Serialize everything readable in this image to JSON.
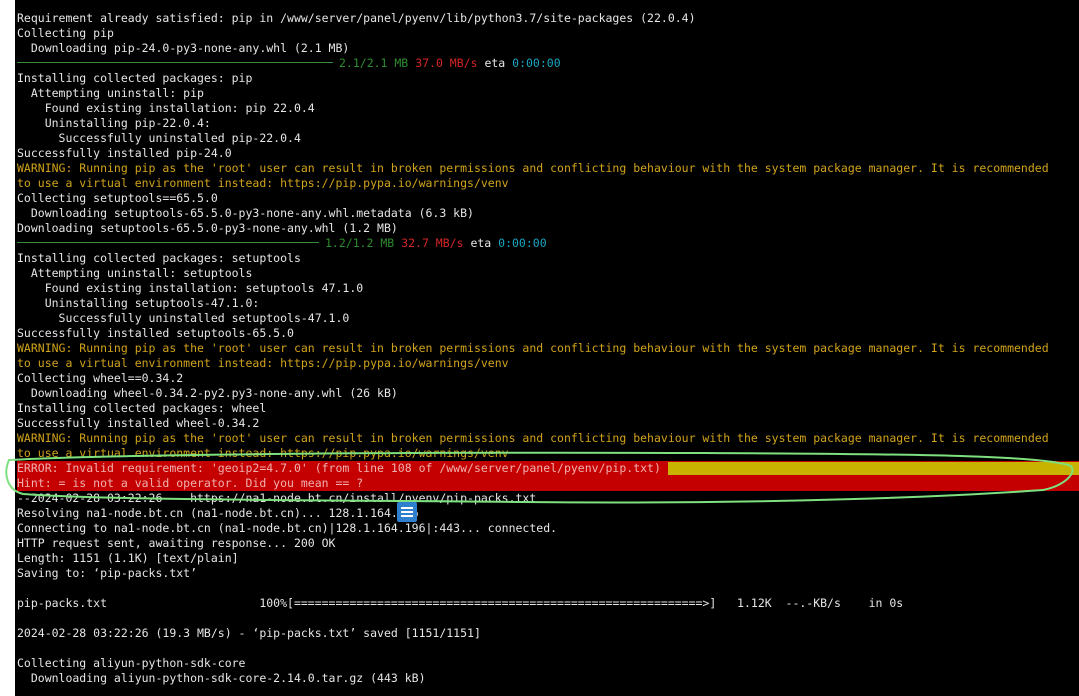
{
  "terminal": {
    "lines": [
      {
        "segs": [
          {
            "t": "Requirement already satisfied: pip in /www/server/panel/pyenv/lib/python3.7/site-packages (22.0.4)",
            "c": "white"
          }
        ]
      },
      {
        "segs": [
          {
            "t": "Collecting pip",
            "c": "white"
          }
        ]
      },
      {
        "segs": [
          {
            "t": "  Downloading pip-24.0-py3-none-any.whl (2.1 MB)",
            "c": "white"
          }
        ]
      },
      {
        "bar": {
          "width": 316,
          "progress": "2.1/2.1 MB",
          "speed": "37.0 MB/s",
          "eta_label": "eta",
          "eta": "0:00:00"
        }
      },
      {
        "segs": [
          {
            "t": "Installing collected packages: pip",
            "c": "white"
          }
        ]
      },
      {
        "segs": [
          {
            "t": "  Attempting uninstall: pip",
            "c": "white"
          }
        ]
      },
      {
        "segs": [
          {
            "t": "    Found existing installation: pip 22.0.4",
            "c": "white"
          }
        ]
      },
      {
        "segs": [
          {
            "t": "    Uninstalling pip-22.0.4:",
            "c": "white"
          }
        ]
      },
      {
        "segs": [
          {
            "t": "      Successfully uninstalled pip-22.0.4",
            "c": "white"
          }
        ]
      },
      {
        "segs": [
          {
            "t": "Successfully installed pip-24.0",
            "c": "white"
          }
        ]
      },
      {
        "segs": [
          {
            "t": "WARNING: Running pip as the 'root' user can result in broken permissions and conflicting behaviour with the system package manager. It is recommended",
            "c": "yellow"
          }
        ]
      },
      {
        "segs": [
          {
            "t": "to use a virtual environment instead: https://pip.pypa.io/warnings/venv",
            "c": "yellow"
          }
        ]
      },
      {
        "segs": [
          {
            "t": "Collecting setuptools==65.5.0",
            "c": "white"
          }
        ]
      },
      {
        "segs": [
          {
            "t": "  Downloading setuptools-65.5.0-py3-none-any.whl.metadata (6.3 kB)",
            "c": "white"
          }
        ]
      },
      {
        "segs": [
          {
            "t": "Downloading setuptools-65.5.0-py3-none-any.whl (1.2 MB)",
            "c": "white"
          }
        ]
      },
      {
        "bar": {
          "width": 302,
          "progress": "1.2/1.2 MB",
          "speed": "32.7 MB/s",
          "eta_label": "eta",
          "eta": "0:00:00"
        }
      },
      {
        "segs": [
          {
            "t": "Installing collected packages: setuptools",
            "c": "white"
          }
        ]
      },
      {
        "segs": [
          {
            "t": "  Attempting uninstall: setuptools",
            "c": "white"
          }
        ]
      },
      {
        "segs": [
          {
            "t": "    Found existing installation: setuptools 47.1.0",
            "c": "white"
          }
        ]
      },
      {
        "segs": [
          {
            "t": "    Uninstalling setuptools-47.1.0:",
            "c": "white"
          }
        ]
      },
      {
        "segs": [
          {
            "t": "      Successfully uninstalled setuptools-47.1.0",
            "c": "white"
          }
        ]
      },
      {
        "segs": [
          {
            "t": "Successfully installed setuptools-65.5.0",
            "c": "white"
          }
        ]
      },
      {
        "segs": [
          {
            "t": "WARNING: Running pip as the 'root' user can result in broken permissions and conflicting behaviour with the system package manager. It is recommended",
            "c": "yellow"
          }
        ]
      },
      {
        "segs": [
          {
            "t": "to use a virtual environment instead: https://pip.pypa.io/warnings/venv",
            "c": "yellow"
          }
        ]
      },
      {
        "segs": [
          {
            "t": "Collecting wheel==0.34.2",
            "c": "white"
          }
        ]
      },
      {
        "segs": [
          {
            "t": "  Downloading wheel-0.34.2-py2.py3-none-any.whl (26 kB)",
            "c": "white"
          }
        ]
      },
      {
        "segs": [
          {
            "t": "Installing collected packages: wheel",
            "c": "white"
          }
        ]
      },
      {
        "segs": [
          {
            "t": "Successfully installed wheel-0.34.2",
            "c": "white"
          }
        ]
      },
      {
        "segs": [
          {
            "t": "WARNING: Running pip as the 'root' user can result in broken permissions and conflicting behaviour with the system package manager. It is recommended",
            "c": "yellow"
          }
        ]
      },
      {
        "segs": [
          {
            "t": "to use a virtual environment instead: https://pip.pypa.io/warnings/venv",
            "c": "yellow"
          }
        ]
      },
      {
        "error": "a",
        "segs": [
          {
            "t": "ERROR: Invalid requirement: 'geoip2=4.7.0' (from line 108 of /www/server/panel/pyenv/pip.txt)",
            "c": "red"
          }
        ]
      },
      {
        "error": "b",
        "segs": [
          {
            "t": "Hint: = is not a valid operator. Did you mean == ?",
            "c": "red"
          }
        ]
      },
      {
        "segs": [
          {
            "t": "--2024-02-28 03:22:26--  https://na1-node.bt.cn/install/pyenv/pip-packs.txt",
            "c": "white"
          }
        ]
      },
      {
        "segs": [
          {
            "t": "Resolving na1-node.bt.cn (na1-node.bt.cn)... 128.1.164.196",
            "c": "white"
          }
        ]
      },
      {
        "segs": [
          {
            "t": "Connecting to na1-node.bt.cn (na1-node.bt.cn)|128.1.164.196|:443... connected.",
            "c": "white"
          }
        ]
      },
      {
        "segs": [
          {
            "t": "HTTP request sent, awaiting response... 200 OK",
            "c": "white"
          }
        ]
      },
      {
        "segs": [
          {
            "t": "Length: 1151 (1.1K) [text/plain]",
            "c": "white"
          }
        ]
      },
      {
        "segs": [
          {
            "t": "Saving to: ‘pip-packs.txt’",
            "c": "white"
          }
        ]
      },
      {
        "segs": [
          {
            "t": "",
            "c": "white"
          }
        ]
      },
      {
        "segs": [
          {
            "t": "pip-packs.txt                      100%[===========================================================>]   1.12K  --.-KB/s    in 0s",
            "c": "white"
          }
        ]
      },
      {
        "segs": [
          {
            "t": "",
            "c": "white"
          }
        ]
      },
      {
        "segs": [
          {
            "t": "2024-02-28 03:22:26 (19.3 MB/s) - ‘pip-packs.txt’ saved [1151/1151]",
            "c": "white"
          }
        ]
      },
      {
        "segs": [
          {
            "t": "",
            "c": "white"
          }
        ]
      },
      {
        "segs": [
          {
            "t": "Collecting aliyun-python-sdk-core",
            "c": "white"
          }
        ]
      },
      {
        "segs": [
          {
            "t": "  Downloading aliyun-python-sdk-core-2.14.0.tar.gz (443 kB)",
            "c": "white"
          }
        ]
      }
    ]
  },
  "colors": {
    "white": "#e6e6e6",
    "yellow": "#d1a31a",
    "green": "#2e8b2e",
    "red": "#d42525",
    "cyan": "#1ba6c2",
    "error_bg": "#c50000",
    "error_fg": "#f1b0b0",
    "highlight_yellow": "#c8b400",
    "annotation": "#7ee07e"
  },
  "icons": {
    "overlay": "taskbar-app-icon"
  }
}
